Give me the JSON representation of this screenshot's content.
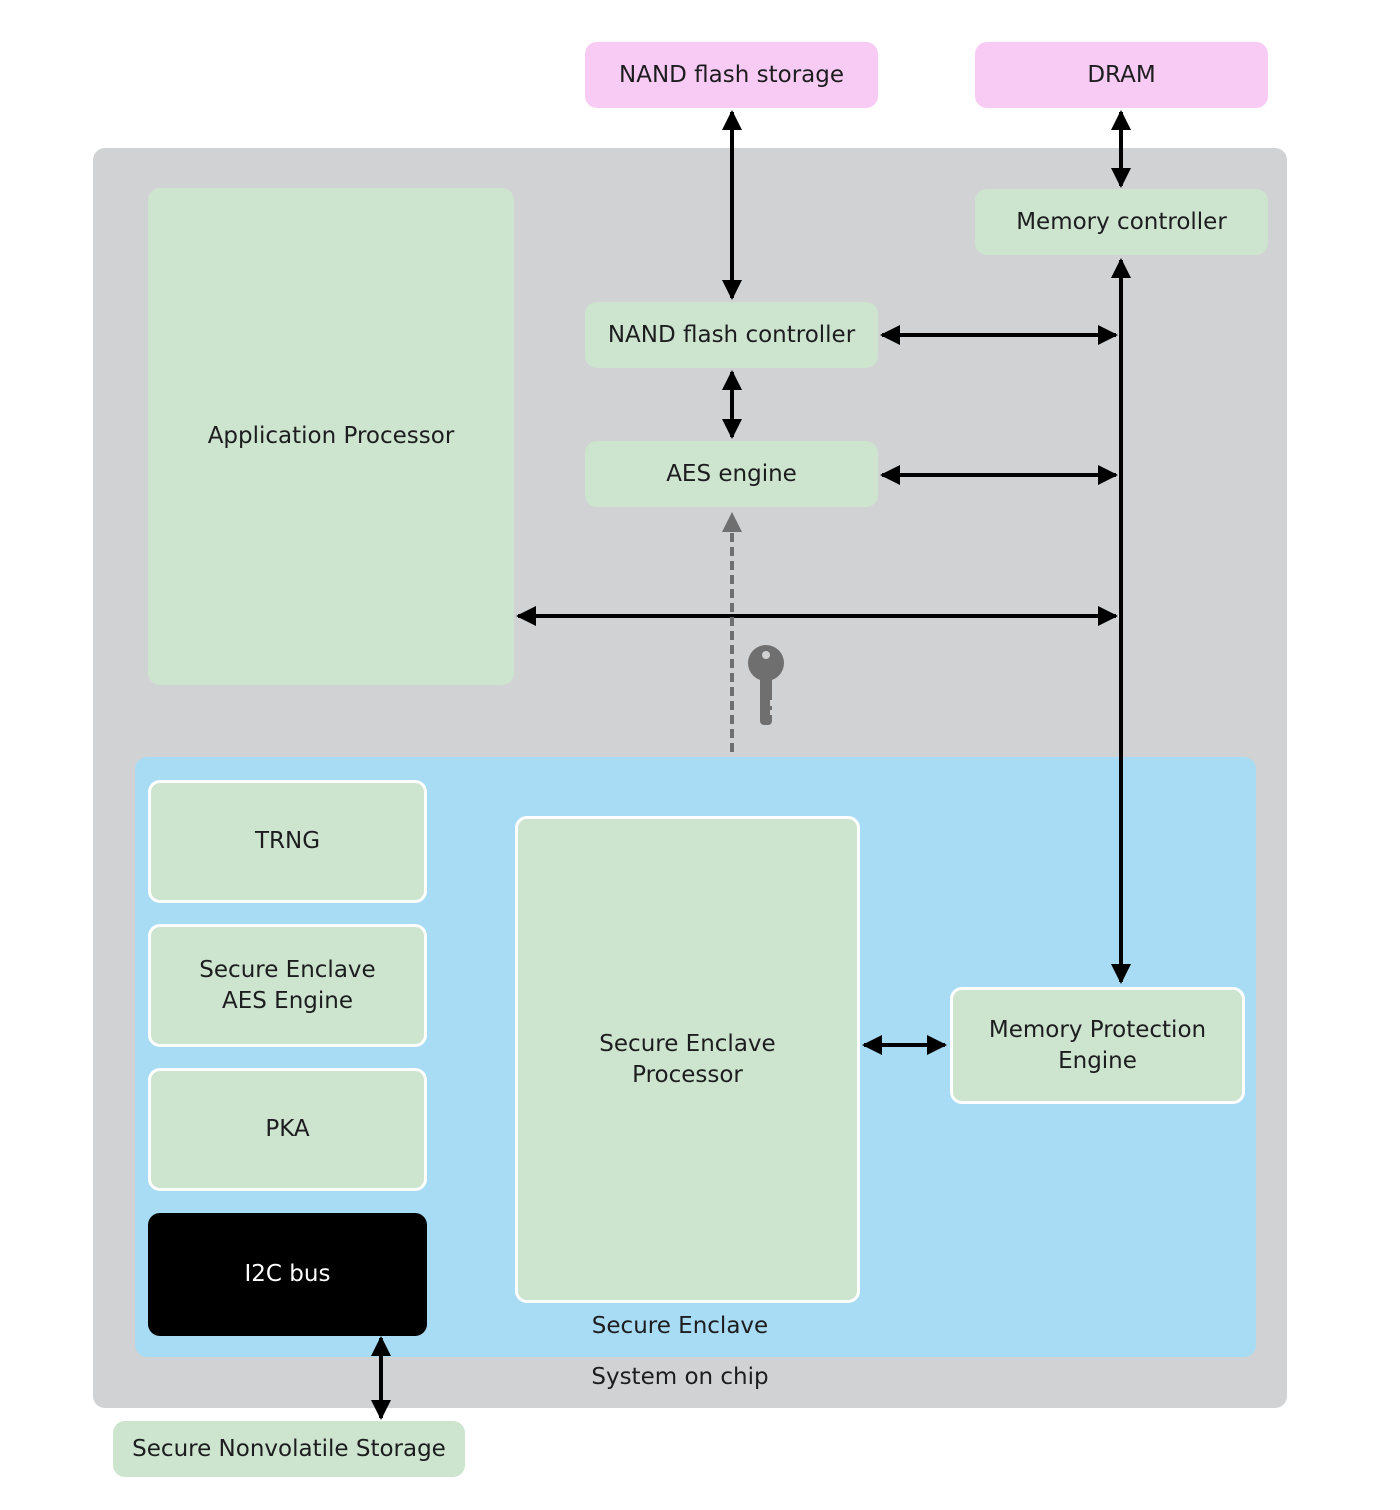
{
  "external": {
    "nand_storage": "NAND flash storage",
    "dram": "DRAM",
    "secure_nonvolatile_storage": "Secure Nonvolatile Storage"
  },
  "soc": {
    "label": "System on chip",
    "application_processor": "Application Processor",
    "memory_controller": "Memory controller",
    "nand_controller": "NAND flash controller",
    "aes_engine": "AES engine"
  },
  "secure_enclave": {
    "label": "Secure Enclave",
    "trng": "TRNG",
    "se_aes_engine": [
      "Secure Enclave",
      "AES Engine"
    ],
    "pka": "PKA",
    "i2c_bus": "I2C bus",
    "sep": [
      "Secure Enclave",
      "Processor"
    ],
    "mpe": [
      "Memory Protection",
      "Engine"
    ]
  },
  "icons": {
    "key": "key-icon"
  },
  "colors": {
    "external": "#f7cbf4",
    "component": "#cde4cf",
    "soc": "#d1d2d3",
    "secure_enclave": "#a8dcf4",
    "i2c": "#000000",
    "key": "#6f6f6f"
  }
}
